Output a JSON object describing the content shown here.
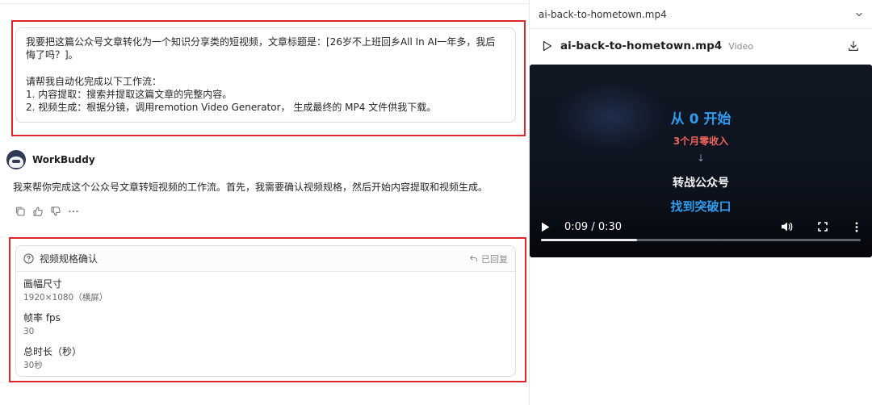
{
  "chat": {
    "user_message": {
      "line1": "我要把这篇公众号文章转化为一个知识分享类的短视频，文章标题是：[26岁不上班回乡All In AI一年多，我后",
      "line2": "悔了吗？]。",
      "line3": "请帮我自动化完成以下工作流：",
      "line4": "1. 内容提取：搜索并提取这篇文章的完整内容。",
      "line5": "2. 视频生成：根据分镜，调用remotion Video Generator， 生成最终的 MP4 文件供我下载。"
    },
    "bot": {
      "name": "WorkBuddy",
      "reply": "我来帮你完成这个公众号文章转短视频的工作流。首先，我需要确认视频规格，然后开始内容提取和视频生成。",
      "actions": [
        "copy-icon",
        "thumbs-up-icon",
        "thumbs-down-icon",
        "more-icon"
      ]
    },
    "spec_card": {
      "title": "视频规格确认",
      "status": "已回复",
      "items": [
        {
          "label": "画幅尺寸",
          "value": "1920×1080（横屏）"
        },
        {
          "label": "帧率 fps",
          "value": "30"
        },
        {
          "label": "总时长（秒）",
          "value": "30秒"
        }
      ]
    }
  },
  "preview": {
    "select_value": "ai-back-to-hometown.mp4",
    "file_name": "ai-back-to-hometown.mp4",
    "file_type": "Video",
    "video": {
      "lines": [
        "从 0 开始",
        "3个月零收入",
        "↓",
        "转战公众号",
        "找到突破口"
      ],
      "current_time": "0:09",
      "duration": "0:30",
      "time_display": "0:09 / 0:30",
      "progress_fraction": 0.3
    }
  },
  "colors": {
    "highlight": "#e0262b",
    "video_blue": "#2e9cf0",
    "video_red": "#f0645c"
  }
}
